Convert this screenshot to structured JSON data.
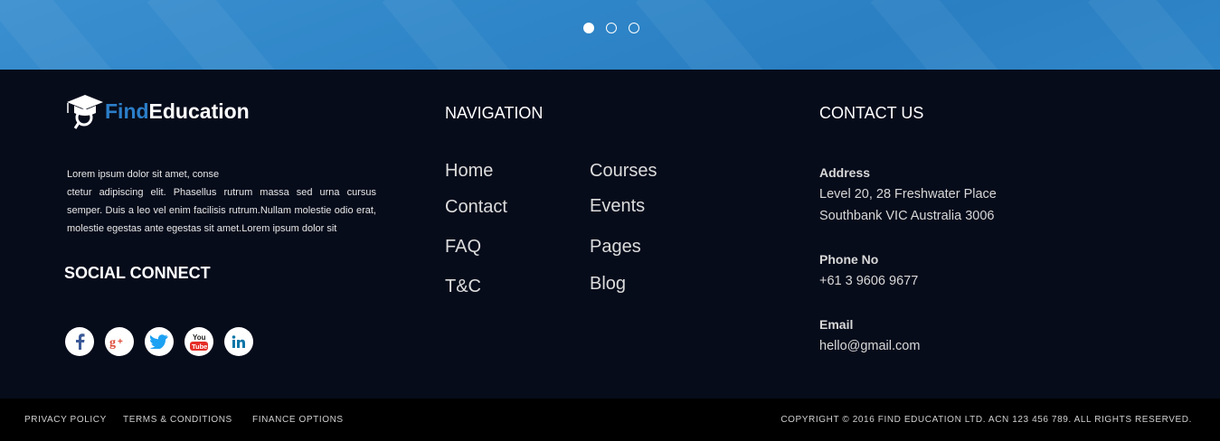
{
  "slider": {
    "dots": 3,
    "active_index": 0
  },
  "brand": {
    "find": "Find",
    "education": "Education",
    "accent_color": "#2b7ec9"
  },
  "about": {
    "line1": "Lorem ipsum dolor sit amet, conse",
    "body": "ctetur adipiscing elit. Phasellus rutrum massa sed urna cursus semper. Duis a leo vel enim facilisis rutrum.Nullam molestie odio erat, molestie egestas ante egestas sit amet.Lorem ipsum dolor sit"
  },
  "social": {
    "title": "SOCIAL CONNECT",
    "icons": [
      "facebook-icon",
      "google-plus-icon",
      "twitter-icon",
      "youtube-icon",
      "linkedin-icon"
    ]
  },
  "navigation": {
    "title": "NAVIGATION",
    "col1": [
      "Home",
      "Contact",
      "FAQ",
      "T&C"
    ],
    "col2": [
      "Courses",
      "Events",
      "Pages",
      "Blog"
    ]
  },
  "contact": {
    "title": "CONTACT US",
    "address_label": "Address",
    "address_line1": "Level 20, 28 Freshwater Place",
    "address_line2": "Southbank VIC Australia 3006",
    "phone_label": "Phone No",
    "phone": "+61 3 9606 9677",
    "email_label": "Email",
    "email": "hello@gmail.com"
  },
  "bottom_bar": {
    "links": [
      "PRIVACY POLICY",
      "TERMS & CONDITIONS",
      "FINANCE OPTIONS"
    ],
    "copyright": "COPYRIGHT © 2016 FIND EDUCATION  LTD. ACN 123 456 789. ALL RIGHTS RESERVED."
  }
}
